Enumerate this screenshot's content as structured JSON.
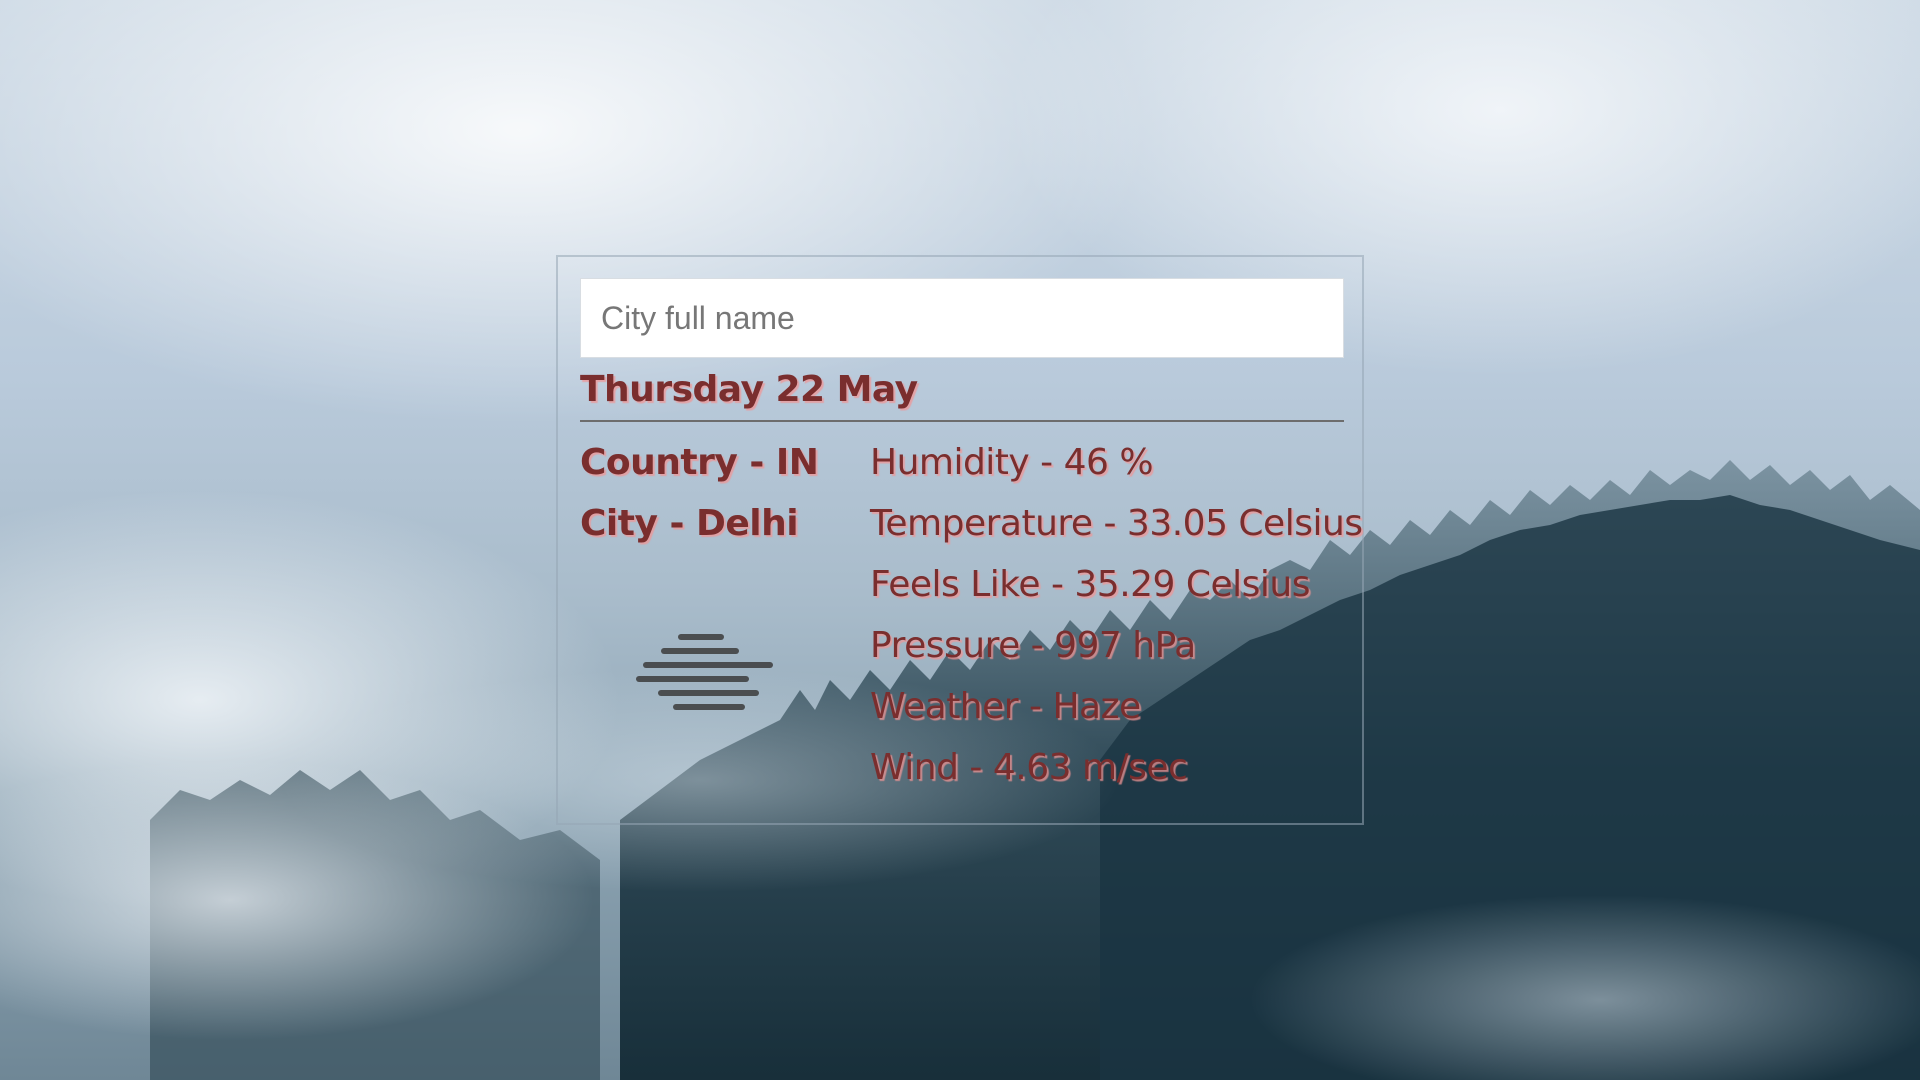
{
  "search": {
    "placeholder": "City full name",
    "value": ""
  },
  "date": "Thursday 22 May",
  "location": {
    "country": "Country - IN",
    "city": "City - Delhi"
  },
  "details": [
    "Humidity - 46 %",
    "Temperature - 33.05 Celsius",
    "Feels Like - 35.29 Celsius",
    "Pressure - 997 hPa",
    "Weather - Haze",
    "Wind - 4.63 m/sec"
  ],
  "weather_icon": "haze-icon",
  "colors": {
    "text": "#7a2e2e",
    "text_shadow": "#f09696",
    "panel_border": "#96a5b4"
  }
}
